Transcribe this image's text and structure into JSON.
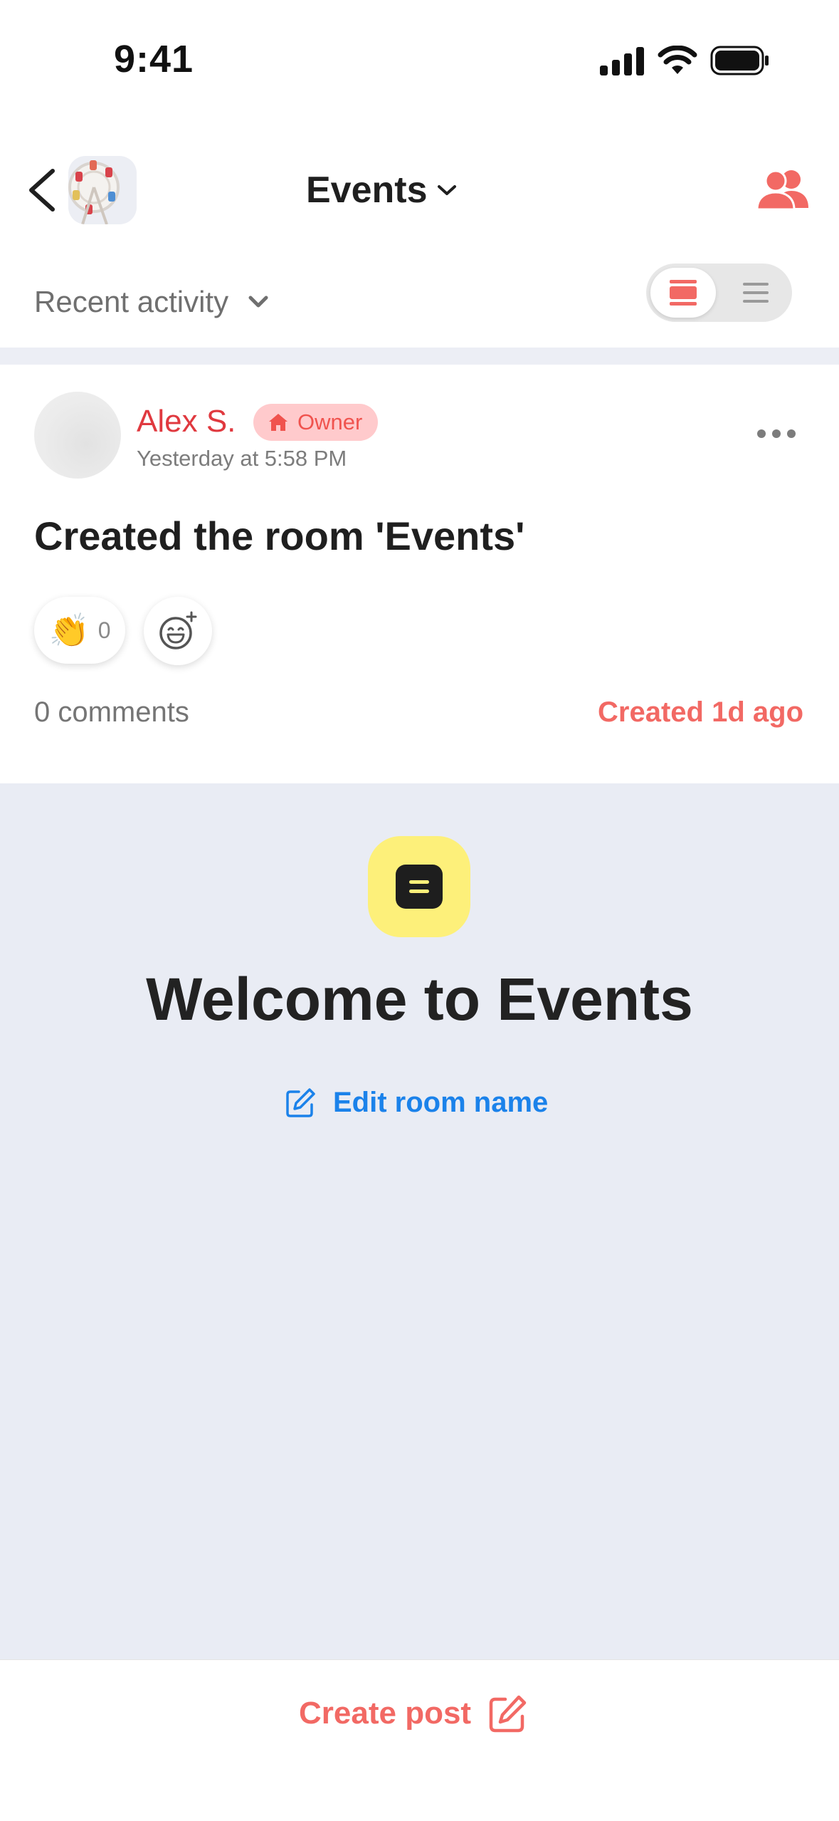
{
  "status_bar": {
    "time": "9:41"
  },
  "header": {
    "room_title": "Events",
    "sort_label": "Recent activity"
  },
  "post": {
    "author": "Alex S.",
    "badge": "Owner",
    "time": "Yesterday at 5:58 PM",
    "text": "Created the room 'Events'",
    "reaction_emoji": "👏",
    "reaction_count": "0",
    "comments": "0 comments",
    "created": "Created 1d ago"
  },
  "welcome": {
    "title": "Welcome to Events",
    "edit_label": "Edit room name"
  },
  "bottom": {
    "create_label": "Create post"
  },
  "colors": {
    "accent": "#f26964",
    "author": "#e0393f",
    "link": "#1b82ea",
    "background": "#e9ecf4",
    "icon_yellow": "#fdf07a"
  }
}
